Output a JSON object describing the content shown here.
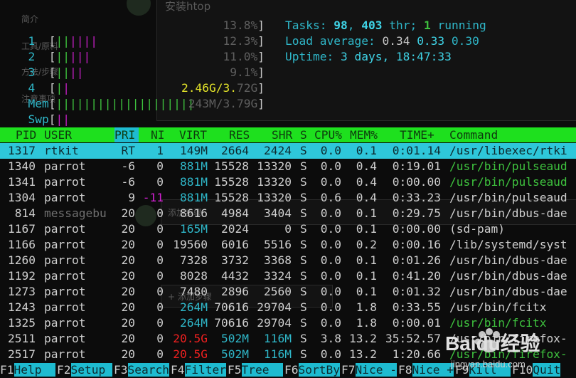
{
  "ghost": {
    "title": "安装htop",
    "menu": [
      "简介",
      "工具/原料",
      "方法/步骤",
      "注意事项"
    ],
    "step_text": "添加步骤",
    "add_text": "+ 添加步骤"
  },
  "meters": [
    {
      "label": "1",
      "bar": "||||||",
      "value": "13.8%"
    },
    {
      "label": "2",
      "bar": "|||||",
      "value": "12.3%"
    },
    {
      "label": "3",
      "bar": "||||",
      "value": "11.0%"
    },
    {
      "label": "4",
      "bar": "||",
      "value": "9.1%"
    },
    {
      "label": "Mem",
      "bar": "||||||||||||||||||||",
      "value_hi": "2.46G/3.",
      "value_lo": "72G"
    },
    {
      "label": "Swp",
      "bar": "||",
      "value": "243M/3.79G"
    }
  ],
  "summary": {
    "tasks_label": "Tasks: ",
    "tasks": "98",
    "thr_sep": ", ",
    "thr": "403",
    "thr_label": " thr; ",
    "running": "1",
    "running_label": " running",
    "load_label": "Load average: ",
    "load1": "0.34",
    "load5": "0.33",
    "load15": "0.30",
    "uptime_label": "Uptime: ",
    "uptime": "3 days, 18:47:33"
  },
  "columns": {
    "pid": "PID",
    "user": "USER",
    "pri": "PRI",
    "ni": "NI",
    "virt": "VIRT",
    "res": "RES",
    "shr": "SHR",
    "s": "S",
    "cpu": "CPU%",
    "mem": "MEM%",
    "time": "TIME+",
    "command": "Command"
  },
  "processes": [
    {
      "pid": "1317",
      "user": "rtkit",
      "pri": "RT",
      "ni": "1",
      "virt": "149M",
      "res": "2664",
      "shr": "2424",
      "s": "S",
      "cpu": "0.0",
      "mem": "0.1",
      "time": "0:01.14",
      "cmd": "/usr/libexec/rtki"
    },
    {
      "pid": "1340",
      "user": "parrot",
      "pri": "-6",
      "ni": "0",
      "virt": "881M",
      "res": "15528",
      "shr": "13320",
      "s": "S",
      "cpu": "0.0",
      "mem": "0.4",
      "time": "0:19.01",
      "cmd": "/usr/bin/pulseaud"
    },
    {
      "pid": "1341",
      "user": "parrot",
      "pri": "-6",
      "ni": "0",
      "virt": "881M",
      "res": "15528",
      "shr": "13320",
      "s": "S",
      "cpu": "0.0",
      "mem": "0.4",
      "time": "0:00.00",
      "cmd": "/usr/bin/pulseaud"
    },
    {
      "pid": "1304",
      "user": "parrot",
      "pri": "9",
      "ni": "-11",
      "virt": "881M",
      "res": "15528",
      "shr": "13320",
      "s": "S",
      "cpu": "0.6",
      "mem": "0.4",
      "time": "0:33.23",
      "cmd": "/usr/bin/pulseaud"
    },
    {
      "pid": "814",
      "user": "messagebu",
      "pri": "20",
      "ni": "0",
      "virt": "8616",
      "res": "4984",
      "shr": "3404",
      "s": "S",
      "cpu": "0.0",
      "mem": "0.1",
      "time": "0:29.75",
      "cmd": "/usr/bin/dbus-dae"
    },
    {
      "pid": "1167",
      "user": "parrot",
      "pri": "20",
      "ni": "0",
      "virt": "165M",
      "res": "2024",
      "shr": "0",
      "s": "S",
      "cpu": "0.0",
      "mem": "0.1",
      "time": "0:00.00",
      "cmd": "(sd-pam)"
    },
    {
      "pid": "1166",
      "user": "parrot",
      "pri": "20",
      "ni": "0",
      "virt": "19560",
      "res": "6016",
      "shr": "5516",
      "s": "S",
      "cpu": "0.0",
      "mem": "0.2",
      "time": "0:00.16",
      "cmd": "/lib/systemd/syst"
    },
    {
      "pid": "1260",
      "user": "parrot",
      "pri": "20",
      "ni": "0",
      "virt": "7328",
      "res": "3732",
      "shr": "3368",
      "s": "S",
      "cpu": "0.0",
      "mem": "0.1",
      "time": "0:01.26",
      "cmd": "/usr/bin/dbus-dae"
    },
    {
      "pid": "1192",
      "user": "parrot",
      "pri": "20",
      "ni": "0",
      "virt": "8028",
      "res": "4432",
      "shr": "3324",
      "s": "S",
      "cpu": "0.0",
      "mem": "0.1",
      "time": "0:41.20",
      "cmd": "/usr/bin/dbus-dae"
    },
    {
      "pid": "1273",
      "user": "parrot",
      "pri": "20",
      "ni": "0",
      "virt": "7480",
      "res": "2896",
      "shr": "2560",
      "s": "S",
      "cpu": "0.0",
      "mem": "0.1",
      "time": "0:01.32",
      "cmd": "/usr/bin/dbus-dae"
    },
    {
      "pid": "1243",
      "user": "parrot",
      "pri": "20",
      "ni": "0",
      "virt": "264M",
      "res": "70616",
      "shr": "29704",
      "s": "S",
      "cpu": "0.0",
      "mem": "1.8",
      "time": "0:33.55",
      "cmd": "/usr/bin/fcitx"
    },
    {
      "pid": "1325",
      "user": "parrot",
      "pri": "20",
      "ni": "0",
      "virt": "264M",
      "res": "70616",
      "shr": "29704",
      "s": "S",
      "cpu": "0.0",
      "mem": "1.8",
      "time": "0:00.01",
      "cmd": "/usr/bin/fcitx"
    },
    {
      "pid": "2511",
      "user": "parrot",
      "pri": "20",
      "ni": "0",
      "virt": "20.5G",
      "res": "502M",
      "shr": "116M",
      "s": "S",
      "cpu": "3.8",
      "mem": "13.2",
      "time": "35:52.57",
      "cmd": "/usr/bin/firefox-"
    },
    {
      "pid": "2517",
      "user": "parrot",
      "pri": "20",
      "ni": "0",
      "virt": "20.5G",
      "res": "502M",
      "shr": "116M",
      "s": "S",
      "cpu": "0.0",
      "mem": "13.2",
      "time": "1:20.66",
      "cmd": "/usr/bin/firefox-"
    }
  ],
  "footer": [
    {
      "key": "F1",
      "label": "Help  "
    },
    {
      "key": "F2",
      "label": "Setup "
    },
    {
      "key": "F3",
      "label": "Search"
    },
    {
      "key": "F4",
      "label": "Filter"
    },
    {
      "key": "F5",
      "label": "Tree  "
    },
    {
      "key": "F6",
      "label": "SortBy"
    },
    {
      "key": "F7",
      "label": "Nice -"
    },
    {
      "key": "F8",
      "label": "Nice +"
    },
    {
      "key": "F9",
      "label": "Kill  "
    },
    {
      "key": "F10",
      "label": "Quit"
    }
  ],
  "watermark": {
    "brand": "Baidu经验",
    "url": "jingyan.baidu.com"
  }
}
